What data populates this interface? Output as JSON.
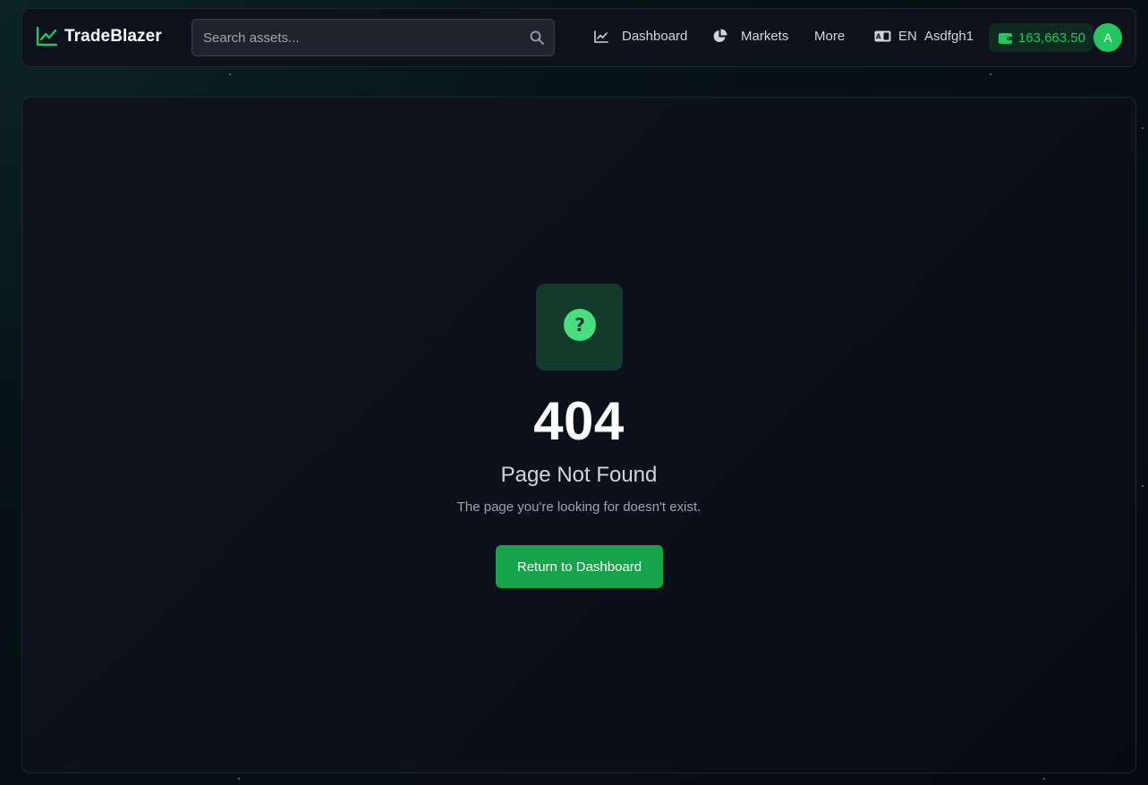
{
  "brand": {
    "name": "TradeBlazer",
    "icon": "chart-line-icon"
  },
  "search": {
    "placeholder": "Search assets...",
    "value": "",
    "icon": "search-icon"
  },
  "nav": {
    "items": [
      {
        "label": "Dashboard",
        "icon": "chart-line-icon"
      },
      {
        "label": "Markets",
        "icon": "pie-chart-icon"
      },
      {
        "label": "More"
      }
    ],
    "language": {
      "label": "EN",
      "icon": "language-icon"
    },
    "username": "Asdfgh1",
    "balance": {
      "value": "163,663.50",
      "icon": "wallet-icon"
    },
    "avatar": "A"
  },
  "error": {
    "icon": "question-circle-icon",
    "code": "404",
    "title": "Page Not Found",
    "message": "The page you're looking for doesn't exist.",
    "button_label": "Return to Dashboard"
  },
  "colors": {
    "accent": "#22c55e",
    "button": "#16a34a",
    "background": "#0d111b"
  }
}
